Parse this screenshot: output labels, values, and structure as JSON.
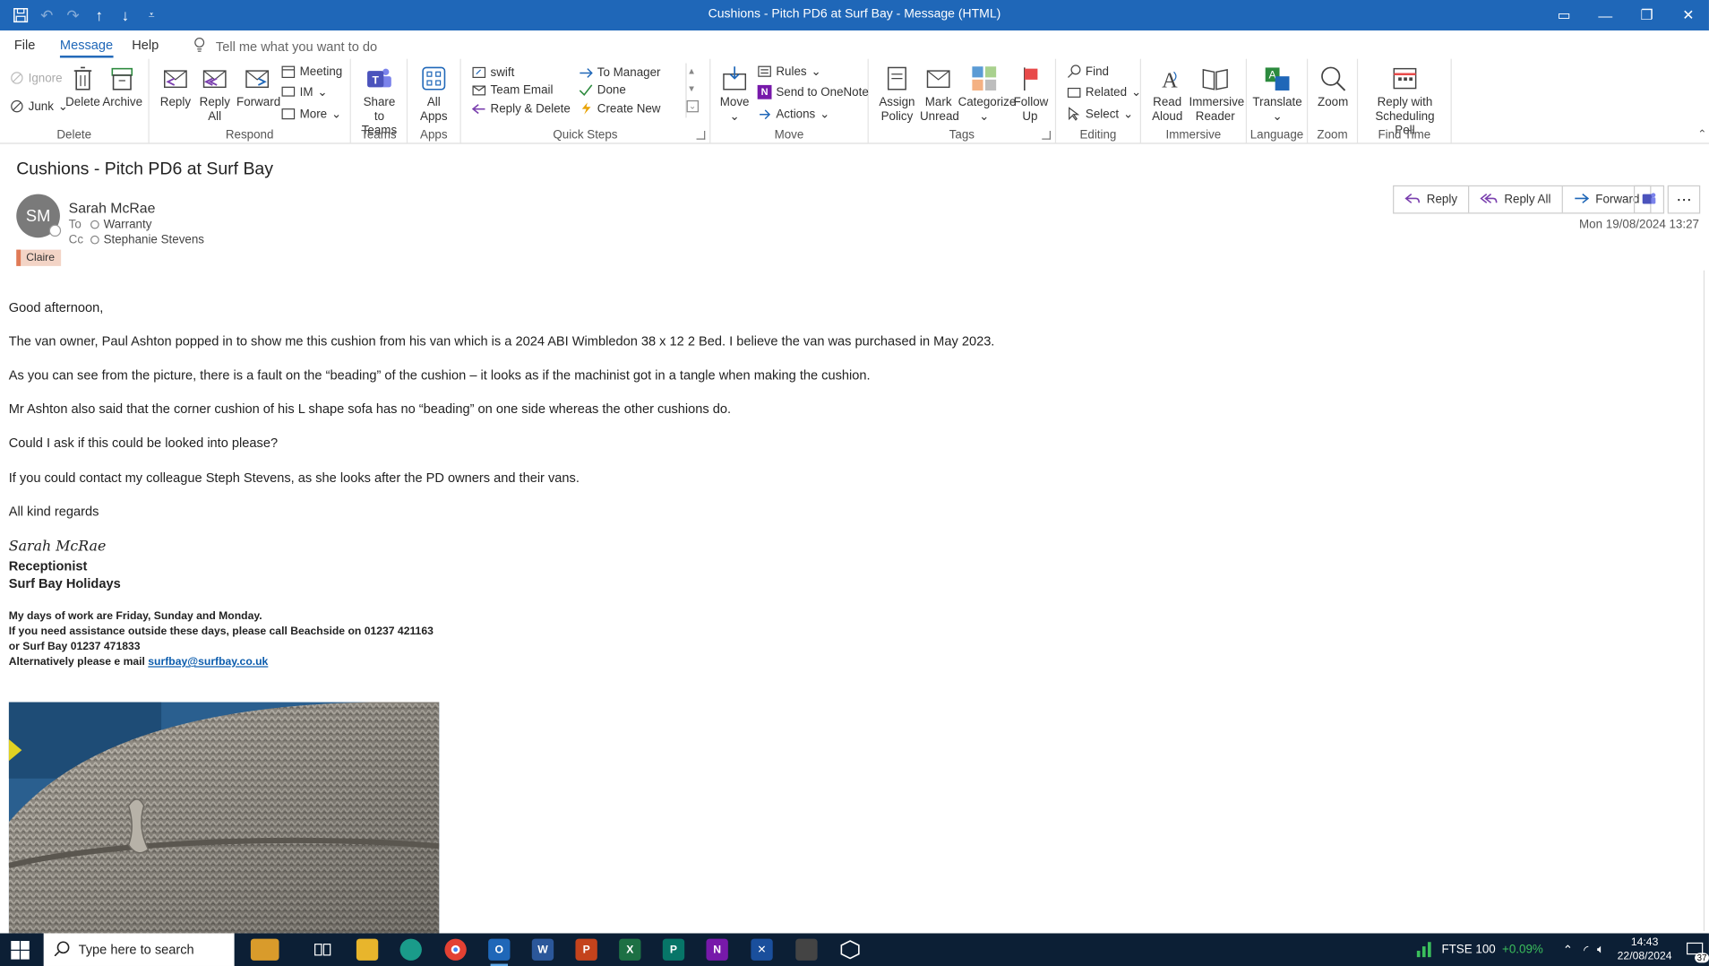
{
  "window": {
    "title": "Cushions - Pitch PD6 at Surf Bay  -  Message (HTML)"
  },
  "menu": {
    "tabs": [
      "File",
      "Message",
      "Help"
    ],
    "tell_me": "Tell me what you want to do"
  },
  "ribbon": {
    "delete_group": {
      "label": "Delete",
      "ignore": "Ignore",
      "junk": "Junk",
      "delete": "Delete",
      "archive": "Archive"
    },
    "respond_group": {
      "label": "Respond",
      "reply": "Reply",
      "reply_all": "Reply All",
      "forward": "Forward",
      "meeting": "Meeting",
      "im": "IM",
      "more": "More"
    },
    "teams_group": {
      "label": "Teams",
      "share": "Share to Teams"
    },
    "apps_group": {
      "label": "Apps",
      "all_apps": "All Apps"
    },
    "quick_steps": {
      "label": "Quick Steps",
      "items": [
        "swift",
        "Team Email",
        "Reply & Delete",
        "To Manager",
        "Done",
        "Create New"
      ]
    },
    "move_group": {
      "label": "Move",
      "move": "Move",
      "rules": "Rules",
      "onenote": "Send to OneNote",
      "actions": "Actions"
    },
    "tags_group": {
      "label": "Tags",
      "assign_policy": "Assign Policy",
      "mark_unread": "Mark Unread",
      "categorize": "Categorize",
      "follow_up": "Follow Up"
    },
    "editing_group": {
      "label": "Editing",
      "find": "Find",
      "related": "Related",
      "select": "Select"
    },
    "immersive_group": {
      "label": "Immersive",
      "read_aloud": "Read Aloud",
      "immersive_reader": "Immersive Reader"
    },
    "language_group": {
      "label": "Language",
      "translate": "Translate"
    },
    "zoom_group": {
      "label": "Zoom",
      "zoom": "Zoom"
    },
    "findtime_group": {
      "label": "Find Time",
      "reply_poll": "Reply with Scheduling Poll"
    }
  },
  "message": {
    "subject": "Cushions - Pitch PD6 at Surf Bay",
    "initials": "SM",
    "sender": "Sarah McRae",
    "to_label": "To",
    "to": "Warranty",
    "cc_label": "Cc",
    "cc": "Stephanie Stevens",
    "category": "Claire",
    "date": "Mon 19/08/2024 13:27",
    "actions": {
      "reply": "Reply",
      "reply_all": "Reply All",
      "forward": "Forward"
    },
    "body": {
      "greeting": "Good afternoon,",
      "p1": "The van owner, Paul Ashton popped in to show me this cushion from his van which is a  2024 ABI Wimbledon 38 x 12  2 Bed. I believe the van was purchased in May 2023.",
      "p2": "As you can see from the picture, there is a fault on the “beading” of the cushion – it looks as if the machinist got in a tangle when making the cushion.",
      "p3": "Mr Ashton also said that the corner cushion of his L shape sofa has no “beading” on one side whereas the other cushions do.",
      "p4": "Could I ask if this could be looked into please?",
      "p5": "If you could contact my colleague Steph Stevens, as she looks after the PD owners and their vans.",
      "closing": "All kind regards"
    },
    "signature": {
      "name": "Sarah McRae",
      "role": "Receptionist",
      "company": "Surf Bay Holidays",
      "line1": "My days of work are Friday, Sunday and Monday.",
      "line2": "If you need assistance outside these days, please call Beachside on 01237 421163",
      "line3": "or Surf Bay 01237 471833",
      "line4_prefix": "Alternatively please e mail ",
      "email": "surfbay@surfbay.co.uk"
    }
  },
  "taskbar": {
    "search_placeholder": "Type here to search",
    "ticker_name": "FTSE 100",
    "ticker_change": "+0.09%",
    "time": "14:43",
    "date": "22/08/2024",
    "notifications": "37"
  }
}
